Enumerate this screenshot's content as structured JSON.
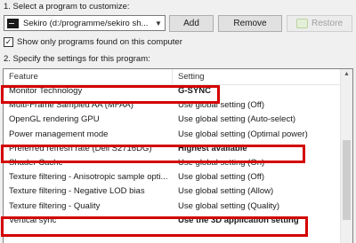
{
  "labels": {
    "select_program": "1. Select a program to customize:",
    "specify_settings": "2. Specify the settings for this program:"
  },
  "program": {
    "selected": "Sekiro (d:/programme/sekiro sh..."
  },
  "buttons": {
    "add": "Add",
    "remove": "Remove",
    "restore": "Restore"
  },
  "checkbox": {
    "label": "Show only programs found on this computer",
    "checked": true,
    "mark": "✓"
  },
  "table": {
    "headers": {
      "feature": "Feature",
      "setting": "Setting"
    },
    "rows": [
      {
        "feature": "Monitor Technology",
        "setting": "G-SYNC",
        "bold": true
      },
      {
        "feature": "Multi-Frame Sampled AA (MFAA)",
        "setting": "Use global setting (Off)",
        "bold": false
      },
      {
        "feature": "OpenGL rendering GPU",
        "setting": "Use global setting (Auto-select)",
        "bold": false
      },
      {
        "feature": "Power management mode",
        "setting": "Use global setting (Optimal power)",
        "bold": false
      },
      {
        "feature": "Preferred refresh rate (Dell S2716DG)",
        "setting": "Highest available",
        "bold": true
      },
      {
        "feature": "Shader Cache",
        "setting": "Use global setting (On)",
        "bold": false
      },
      {
        "feature": "Texture filtering - Anisotropic sample opti...",
        "setting": "Use global setting (Off)",
        "bold": false
      },
      {
        "feature": "Texture filtering - Negative LOD bias",
        "setting": "Use global setting (Allow)",
        "bold": false
      },
      {
        "feature": "Texture filtering - Quality",
        "setting": "Use global setting (Quality)",
        "bold": false
      },
      {
        "feature": "Vertical sync",
        "setting": "Use the 3D application setting",
        "bold": true
      }
    ]
  },
  "colors": {
    "highlight": "#d40000",
    "window_bg": "#f0f0f0"
  },
  "icons": {
    "program": "app-icon",
    "restore": "nvidia-icon",
    "dropdown": "chevron-down-icon"
  }
}
